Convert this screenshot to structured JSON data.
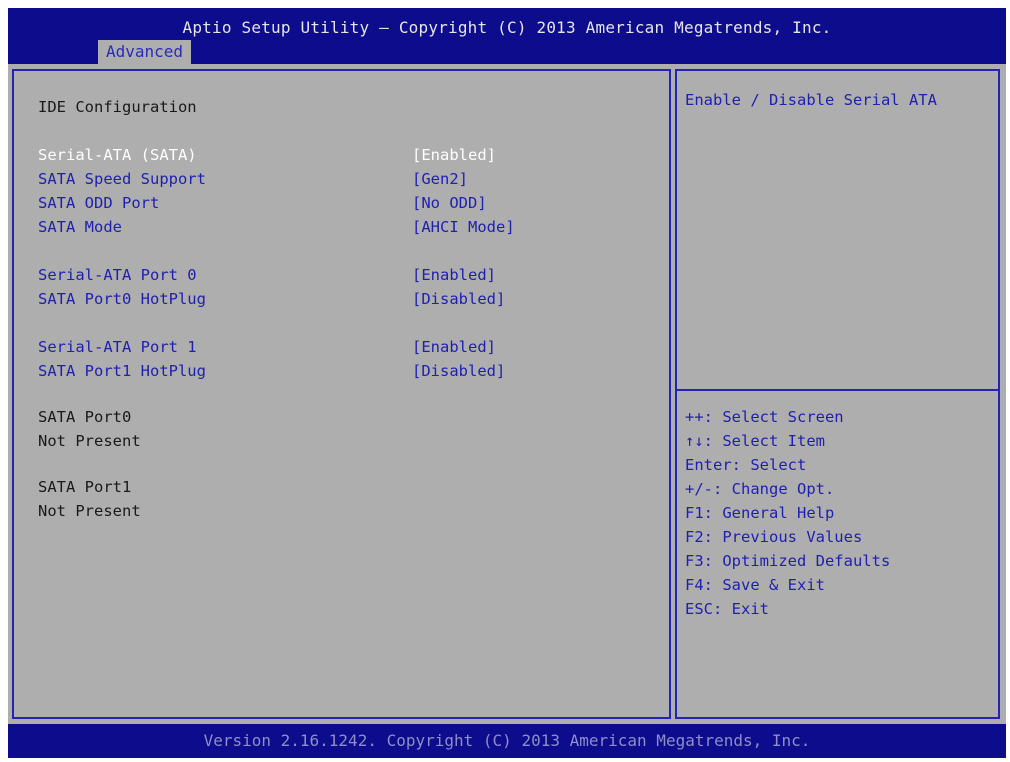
{
  "header": {
    "title": "Aptio Setup Utility – Copyright (C) 2013 American Megatrends, Inc.",
    "tab": "Advanced"
  },
  "main": {
    "heading": "IDE Configuration",
    "items": [
      {
        "label": "Serial-ATA (SATA)",
        "value": "[Enabled]"
      },
      {
        "label": "SATA Speed Support",
        "value": "[Gen2]"
      },
      {
        "label": "SATA ODD Port",
        "value": "[No ODD]"
      },
      {
        "label": "SATA Mode",
        "value": "[AHCI Mode]"
      },
      {
        "label": "Serial-ATA Port 0",
        "value": "[Enabled]"
      },
      {
        "label": "SATA Port0 HotPlug",
        "value": "[Disabled]"
      },
      {
        "label": "Serial-ATA Port 1",
        "value": "[Enabled]"
      },
      {
        "label": "SATA Port1 HotPlug",
        "value": "[Disabled]"
      }
    ],
    "info": [
      {
        "label": "SATA Port0",
        "value": "Not Present"
      },
      {
        "label": "SATA Port1",
        "value": "Not Present"
      }
    ]
  },
  "help": {
    "description": "Enable / Disable Serial ATA",
    "keys": [
      "++: Select Screen",
      "↑↓: Select Item",
      "Enter: Select",
      "+/-: Change Opt.",
      "F1: General Help",
      "F2: Previous Values",
      "F3: Optimized Defaults",
      "F4: Save & Exit",
      "ESC: Exit"
    ]
  },
  "footer": {
    "text": "Version 2.16.1242. Copyright (C) 2013 American Megatrends, Inc."
  },
  "colors": {
    "background": "#aeaeae",
    "bar": "#0c0c8c",
    "accent_text": "#2020b0",
    "selected_text": "#ffffff"
  }
}
